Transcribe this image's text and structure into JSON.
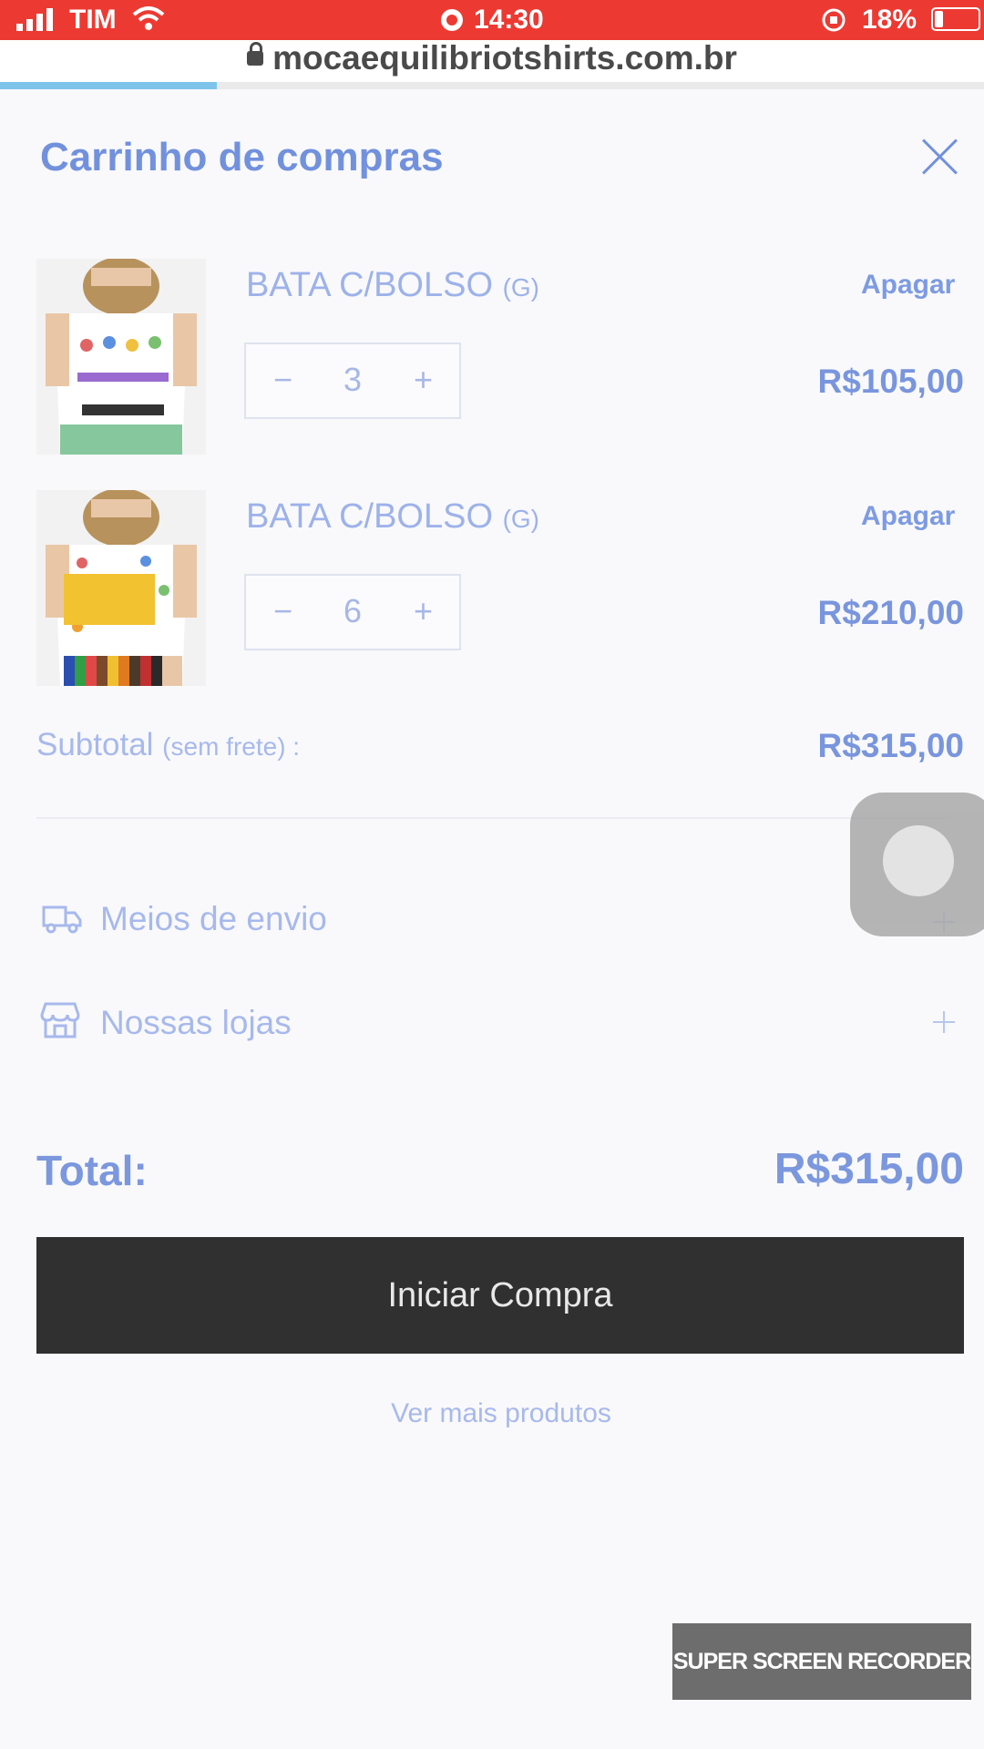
{
  "status_bar": {
    "carrier": "TIM",
    "time": "14:30",
    "battery": "18%"
  },
  "browser": {
    "url": "mocaequilibriotshirts.com.br",
    "load_progress": 0.22
  },
  "cart": {
    "title": "Carrinho de compras",
    "items": [
      {
        "name": "BATA C/BOLSO",
        "size": "(G)",
        "quantity": "3",
        "price": "R$105,00",
        "delete_label": "Apagar"
      },
      {
        "name": "BATA C/BOLSO",
        "size": "(G)",
        "quantity": "6",
        "price": "R$210,00",
        "delete_label": "Apagar"
      }
    ],
    "qty_minus": "−",
    "qty_plus": "+",
    "subtotal_label": "Subtotal",
    "subtotal_note": "(sem frete) :",
    "subtotal_value": "R$315,00",
    "shipping_label": "Meios de envio",
    "stores_label": "Nossas lojas",
    "total_label": "Total:",
    "total_value": "R$315,00",
    "checkout_button": "Iniciar Compra",
    "more_products_link": "Ver mais produtos"
  },
  "overlay": {
    "recorder_badge": "SUPER SCREEN RECORDER"
  },
  "colors": {
    "status_bar": "#ec3a33",
    "accent": "#7291dd",
    "button": "#303030"
  }
}
